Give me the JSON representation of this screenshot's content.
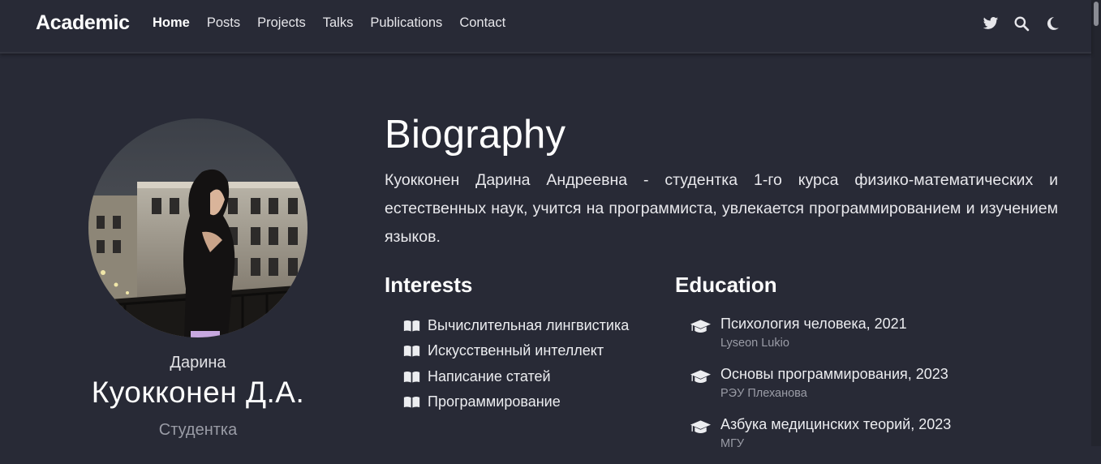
{
  "navbar": {
    "brand": "Academic",
    "links": [
      "Home",
      "Posts",
      "Projects",
      "Talks",
      "Publications",
      "Contact"
    ],
    "active_link": "Home",
    "icons": [
      "twitter-icon",
      "search-icon",
      "moon-icon"
    ]
  },
  "profile": {
    "first_name": "Дарина",
    "name": "Куокконен Д.А.",
    "role": "Студентка"
  },
  "biography": {
    "title": "Biography",
    "text": "Куокконен Дарина Андреевна - студентка 1-го курса физико-математических и естественных наук, учится на программиста, увлекается программированием и изучением языков."
  },
  "interests": {
    "title": "Interests",
    "items": [
      "Вычислительная лингвистика",
      "Искусственный интеллект",
      "Написание статей",
      "Программирование"
    ]
  },
  "education": {
    "title": "Education",
    "items": [
      {
        "course": "Психология человека, 2021",
        "institution": "Lyseon Lukio"
      },
      {
        "course": "Основы программирования, 2023",
        "institution": "РЭУ Плеханова"
      },
      {
        "course": "Азбука медицинских теорий, 2023",
        "institution": "МГУ"
      }
    ]
  },
  "colors": {
    "background": "#282a36",
    "text": "#e8e8ec",
    "muted": "#9a9ca6"
  }
}
